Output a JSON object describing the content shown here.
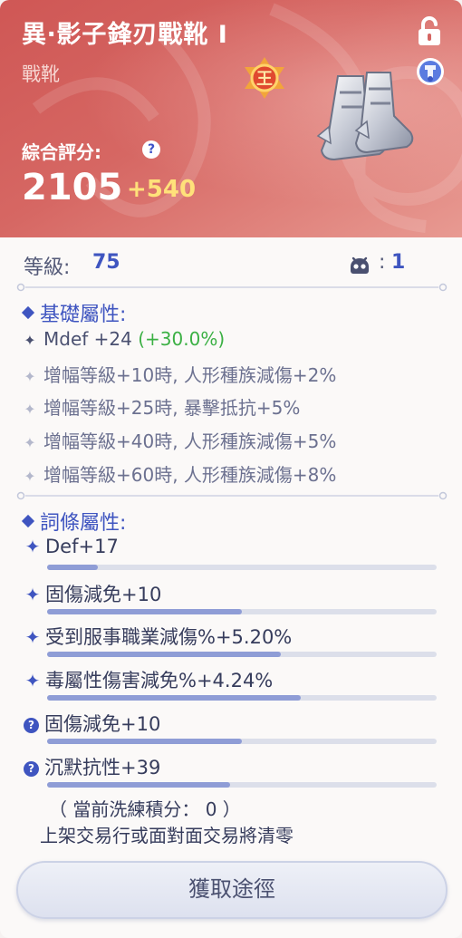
{
  "header": {
    "item_name": "異‧影子鋒刃戰靴 Ⅰ",
    "item_type": "戰靴",
    "rank_badge": "王",
    "score_label": "綜合評分:",
    "score_value": "2105",
    "score_bonus": "+540",
    "icons": [
      "lock-icon",
      "set-icon",
      "help-icon",
      "boots-image"
    ],
    "colors": {
      "header_start": "#cf5755",
      "header_end": "#e89a92",
      "bonus": "#ffe17a"
    }
  },
  "level": {
    "label": "等級:",
    "value": "75",
    "refine_colon": ":",
    "refine_value": "1"
  },
  "base_attributes": {
    "title": "基礎屬性:",
    "main_stat": "Mdef +24",
    "main_bonus": "(+30.0%)",
    "enhancements": [
      "增幅等級+10時, 人形種族減傷+2%",
      "增幅等級+25時, 暴擊抵抗+5%",
      "增幅等級+40時, 人形種族減傷+5%",
      "增幅等級+60時, 人形種族減傷+8%"
    ]
  },
  "affix_attributes": {
    "title": "詞條屬性:",
    "items": [
      {
        "mark": "✦",
        "text": "Def+17",
        "fill": 0.13
      },
      {
        "mark": "✦",
        "text": "固傷減免+10",
        "fill": 0.5
      },
      {
        "mark": "✦",
        "text": "受到服事職業減傷%+5.20%",
        "fill": 0.6
      },
      {
        "mark": "✦",
        "text": "毒屬性傷害減免%+4.24%",
        "fill": 0.65
      },
      {
        "mark": "?",
        "text": "固傷減免+10",
        "fill": 0.5
      },
      {
        "mark": "?",
        "text": "沉默抗性+39",
        "fill": 0.47
      }
    ]
  },
  "notes": {
    "line1": "（ 當前洗練積分： 0 ）",
    "line2": "上架交易行或面對面交易將清零"
  },
  "actions": {
    "source_label": "獲取途徑"
  },
  "theme": {
    "accent": "#3f55c0",
    "bar_fill": "#8f9dd6",
    "bar_track": "#dcdfea",
    "positive": "#3bb044"
  }
}
